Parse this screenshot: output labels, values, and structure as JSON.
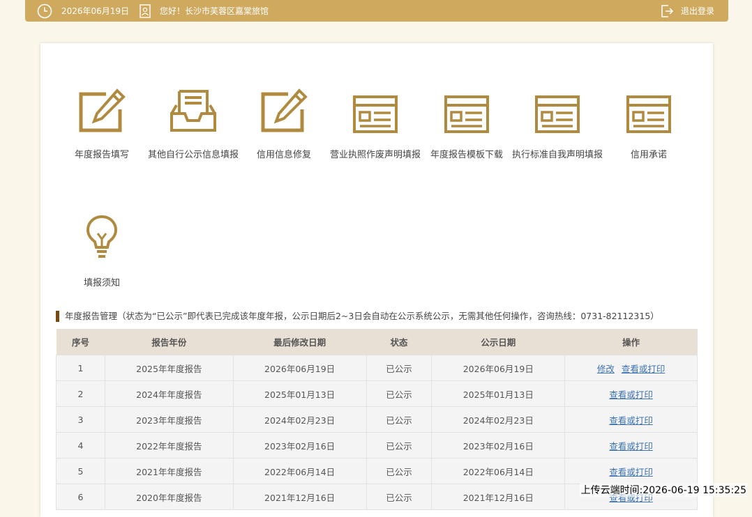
{
  "topbar": {
    "date": "2026年06月19日",
    "greeting": "您好！长沙市芙蓉区嘉棠旅馆",
    "logout": "退出登录"
  },
  "icons": [
    {
      "label": "年度报告填写",
      "icon": "edit-pencil-icon"
    },
    {
      "label": "其他自行公示信息填报",
      "icon": "inbox-tray-icon"
    },
    {
      "label": "信用信息修复",
      "icon": "edit-pencil-icon"
    },
    {
      "label": "营业执照作废声明填报",
      "icon": "form-window-icon"
    },
    {
      "label": "年度报告模板下载",
      "icon": "form-window-icon"
    },
    {
      "label": "执行标准自我声明填报",
      "icon": "form-window-icon"
    },
    {
      "label": "信用承诺",
      "icon": "form-window-icon"
    },
    {
      "label": "填报须知",
      "icon": "lightbulb-icon"
    }
  ],
  "section": {
    "title": "年度报告管理（状态为“已公示”即代表已完成该年度年报，公示日期后2~3日会自动在公示系统公示，无需其他任何操作，咨询热线：0731-82112315）"
  },
  "table": {
    "headers": [
      "序号",
      "报告年份",
      "最后修改日期",
      "状态",
      "公示日期",
      "操作"
    ],
    "rows": [
      {
        "no": "1",
        "year": "2025年年度报告",
        "modified": "2026年06月19日",
        "status": "已公示",
        "published": "2026年06月19日",
        "edit": "修改",
        "view": "查看或打印"
      },
      {
        "no": "2",
        "year": "2024年年度报告",
        "modified": "2025年01月13日",
        "status": "已公示",
        "published": "2025年01月13日",
        "view": "查看或打印"
      },
      {
        "no": "3",
        "year": "2023年年度报告",
        "modified": "2024年02月23日",
        "status": "已公示",
        "published": "2024年02月23日",
        "view": "查看或打印"
      },
      {
        "no": "4",
        "year": "2022年年度报告",
        "modified": "2023年02月16日",
        "status": "已公示",
        "published": "2023年02月16日",
        "view": "查看或打印"
      },
      {
        "no": "5",
        "year": "2021年年度报告",
        "modified": "2022年06月14日",
        "status": "已公示",
        "published": "2022年06月14日",
        "view": "查看或打印"
      },
      {
        "no": "6",
        "year": "2020年年度报告",
        "modified": "2021年12月16日",
        "status": "已公示",
        "published": "2021年12月16日",
        "view": "查看或打印"
      }
    ]
  },
  "watermark": "上传云端时间:2026-06-19 15:35:25",
  "colors": {
    "gold": "#cfa95e",
    "icon": "#b08a3e",
    "link": "#3d73b3",
    "accent_bar": "#7a4a12"
  }
}
